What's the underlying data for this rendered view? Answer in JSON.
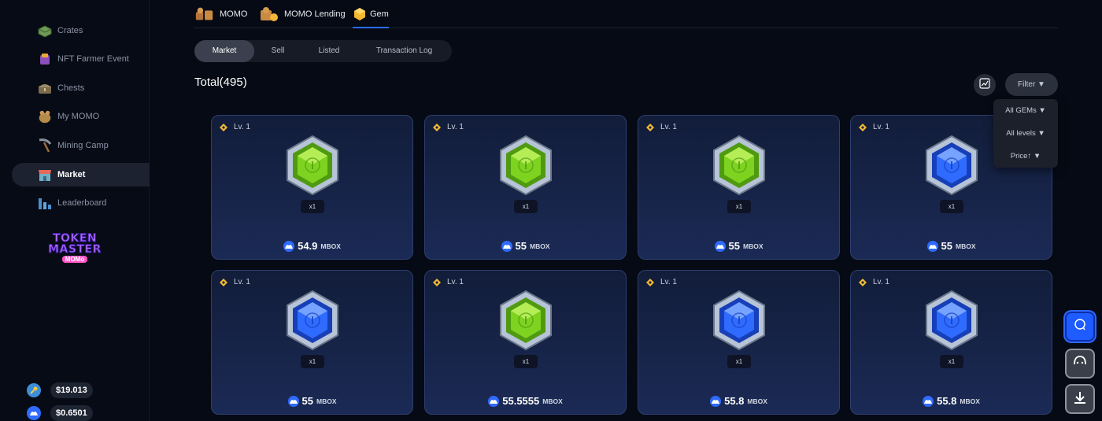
{
  "sidebar": {
    "items": [
      {
        "label": "Crates",
        "icon": "crate-icon",
        "active": false
      },
      {
        "label": "NFT Farmer Event",
        "icon": "farmer-event-icon",
        "active": false
      },
      {
        "label": "Chests",
        "icon": "chest-icon",
        "active": false
      },
      {
        "label": "My MOMO",
        "icon": "momo-icon",
        "active": false
      },
      {
        "label": "Mining Camp",
        "icon": "mining-camp-icon",
        "active": false
      },
      {
        "label": "Market",
        "icon": "market-icon",
        "active": true
      },
      {
        "label": "Leaderboard",
        "icon": "leaderboard-icon",
        "active": false
      }
    ],
    "logo": {
      "line1": "TOKEN",
      "line2": "MASTER",
      "line3": "MOMo"
    },
    "prices": [
      {
        "icon": "key-coin-icon",
        "value": "$19.013"
      },
      {
        "icon": "mbox-coin-icon",
        "value": "$0.6501"
      }
    ]
  },
  "top_tabs": [
    {
      "label": "MOMO",
      "active": false
    },
    {
      "label": "MOMO Lending",
      "active": false
    },
    {
      "label": "Gem",
      "active": true
    }
  ],
  "sub_tabs": [
    {
      "label": "Market",
      "active": true
    },
    {
      "label": "Sell",
      "active": false
    },
    {
      "label": "Listed",
      "active": false
    },
    {
      "label": "Transaction Log",
      "active": false
    }
  ],
  "total_label": "Total(495)",
  "filter": {
    "label": "Filter ▼",
    "options": [
      "All GEMs ▼",
      "All levels ▼",
      "Price↑ ▼"
    ]
  },
  "cards": [
    {
      "level": "Lv. 1",
      "gem_color": "green",
      "qty": "x1",
      "price": "54.9",
      "unit": "MBOX"
    },
    {
      "level": "Lv. 1",
      "gem_color": "green",
      "qty": "x1",
      "price": "55",
      "unit": "MBOX"
    },
    {
      "level": "Lv. 1",
      "gem_color": "green",
      "qty": "x1",
      "price": "55",
      "unit": "MBOX"
    },
    {
      "level": "Lv. 1",
      "gem_color": "blue",
      "qty": "x1",
      "price": "55",
      "unit": "MBOX"
    },
    {
      "level": "Lv. 1",
      "gem_color": "blue",
      "qty": "x1",
      "price": "55",
      "unit": "MBOX"
    },
    {
      "level": "Lv. 1",
      "gem_color": "green",
      "qty": "x1",
      "price": "55.5555",
      "unit": "MBOX"
    },
    {
      "level": "Lv. 1",
      "gem_color": "blue",
      "qty": "x1",
      "price": "55.8",
      "unit": "MBOX"
    },
    {
      "level": "Lv. 1",
      "gem_color": "blue",
      "qty": "x1",
      "price": "55.8",
      "unit": "MBOX"
    }
  ],
  "colors": {
    "accent": "#2a6cff",
    "gem_green": "#7ed321",
    "gem_blue": "#2f6bff",
    "card_bg": "#17234a",
    "bnb_gold": "#f3ba2f"
  },
  "fab": [
    "chat-icon",
    "support-icon",
    "download-icon"
  ]
}
